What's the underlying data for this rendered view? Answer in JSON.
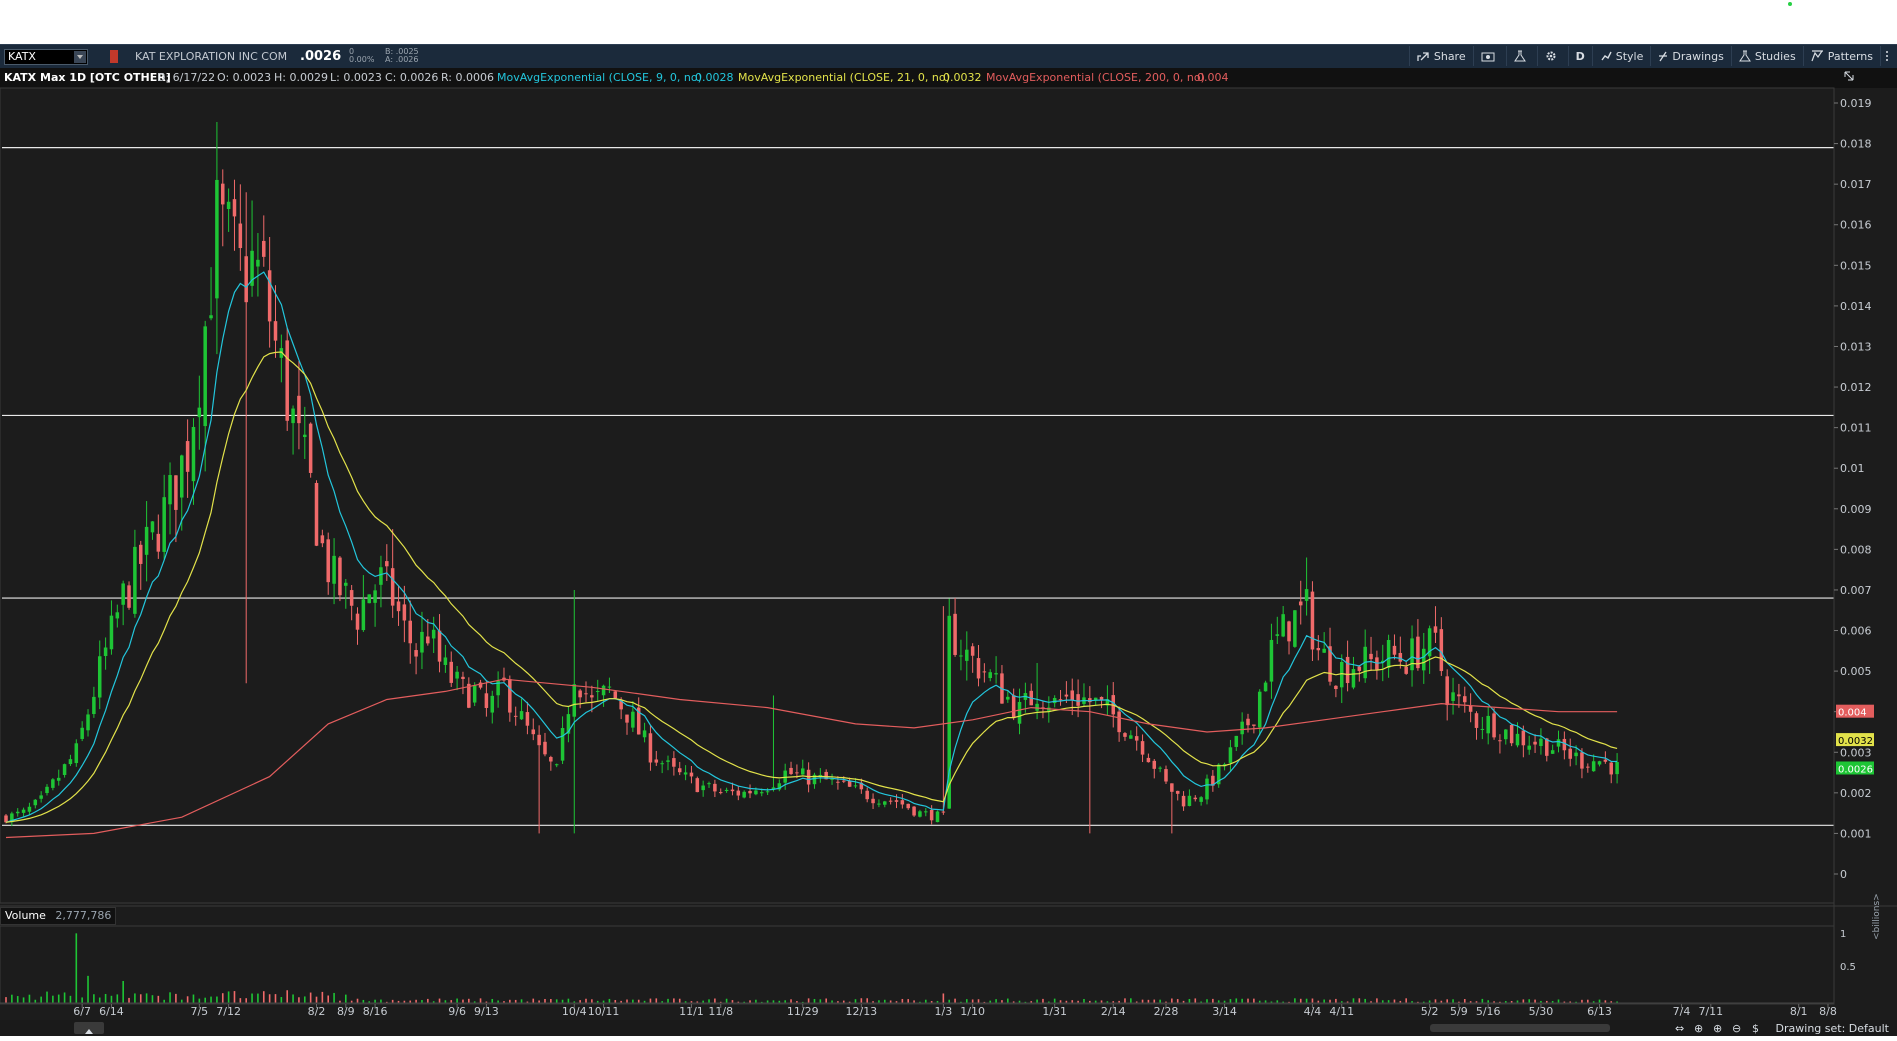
{
  "toolbar": {
    "symbol": "KATX",
    "company": "KAT EXPLORATION INC COM",
    "last": ".0026",
    "change": "0",
    "change_pct": "0.00%",
    "bid": "B: .0025",
    "ask": "A: .0026",
    "buttons": {
      "share": "Share",
      "period": "D",
      "style": "Style",
      "drawings": "Drawings",
      "studies": "Studies",
      "patterns": "Patterns"
    }
  },
  "header": {
    "title": "KATX Max 1D [OTC OTHER]",
    "date": "D: 6/17/22",
    "open": "O: 0.0023",
    "high": "H: 0.0029",
    "low": "L: 0.0023",
    "close": "C: 0.0026",
    "range": "R: 0.0006",
    "ema9_label": "MovAvgExponential (CLOSE, 9, 0, no)",
    "ema9_value": "0.0028",
    "ema21_label": "MovAvgExponential (CLOSE, 21, 0, no)",
    "ema21_value": "0.0032",
    "ema200_label": "MovAvgExponential (CLOSE, 200, 0, no)",
    "ema200_value": "0.004"
  },
  "volume_panel": {
    "label": "Volume",
    "value": "2,777,786",
    "unit": "<billions>",
    "ticks": [
      "1",
      "0.5"
    ]
  },
  "footer": {
    "drawing_set": "Drawing set: Default"
  },
  "colors": {
    "up": "#1ec535",
    "down": "#f06a6a",
    "ema9": "#23c6dc",
    "ema21": "#e2e24a",
    "ema200": "#e35d5d"
  },
  "chart_data": {
    "type": "candlestick",
    "ylim": [
      0,
      0.0195
    ],
    "y_ticks": [
      "0.019",
      "0.018",
      "0.017",
      "0.016",
      "0.015",
      "0.014",
      "0.013",
      "0.012",
      "0.011",
      "0.01",
      "0.009",
      "0.008",
      "0.007",
      "0.006",
      "0.005",
      "0.004",
      "0.003",
      "0.002",
      "0.001",
      "0"
    ],
    "x_ticks": [
      {
        "label": "6/7",
        "i": 13
      },
      {
        "label": "6/14",
        "i": 18
      },
      {
        "label": "7/5",
        "i": 33
      },
      {
        "label": "7/12",
        "i": 38
      },
      {
        "label": "8/2",
        "i": 53
      },
      {
        "label": "8/9",
        "i": 58
      },
      {
        "label": "8/16",
        "i": 63
      },
      {
        "label": "9/6",
        "i": 77
      },
      {
        "label": "9/13",
        "i": 82
      },
      {
        "label": "10/4",
        "i": 97
      },
      {
        "label": "10/11",
        "i": 102
      },
      {
        "label": "11/1",
        "i": 117
      },
      {
        "label": "11/8",
        "i": 122
      },
      {
        "label": "11/29",
        "i": 136
      },
      {
        "label": "12/13",
        "i": 146
      },
      {
        "label": "1/3",
        "i": 160
      },
      {
        "label": "1/10",
        "i": 165
      },
      {
        "label": "1/31",
        "i": 179
      },
      {
        "label": "2/14",
        "i": 189
      },
      {
        "label": "2/28",
        "i": 198
      },
      {
        "label": "3/14",
        "i": 208
      },
      {
        "label": "4/4",
        "i": 223
      },
      {
        "label": "4/11",
        "i": 228
      },
      {
        "label": "5/2",
        "i": 243
      },
      {
        "label": "5/9",
        "i": 248
      },
      {
        "label": "5/16",
        "i": 253
      },
      {
        "label": "5/30",
        "i": 262
      },
      {
        "label": "6/13",
        "i": 272
      },
      {
        "label": "7/4",
        "i": 286
      },
      {
        "label": "7/11",
        "i": 291
      },
      {
        "label": "8/1",
        "i": 306
      },
      {
        "label": "8/8",
        "i": 311
      }
    ],
    "horizontal_lines": [
      0.0179,
      0.0113,
      0.0068,
      0.0012
    ],
    "price_badges": [
      {
        "value": "0.004",
        "y": 0.004,
        "color": "#e35d5d",
        "text": "#ffffff"
      },
      {
        "value": "0.0032",
        "y": 0.0033,
        "color": "#e2e24a",
        "text": "#000000"
      },
      {
        "value": "0.0026",
        "y": 0.0026,
        "color": "#1ec535",
        "text": "#ffffff"
      }
    ],
    "anchors": [
      [
        0,
        0.0014
      ],
      [
        3,
        0.0015
      ],
      [
        6,
        0.0018
      ],
      [
        9,
        0.0024
      ],
      [
        12,
        0.003
      ],
      [
        16,
        0.005
      ],
      [
        20,
        0.0068
      ],
      [
        24,
        0.008
      ],
      [
        28,
        0.0092
      ],
      [
        31,
        0.0105
      ],
      [
        34,
        0.0135
      ],
      [
        36,
        0.016
      ],
      [
        38,
        0.0155
      ],
      [
        40,
        0.0148
      ],
      [
        42,
        0.015
      ],
      [
        44,
        0.0145
      ],
      [
        46,
        0.013
      ],
      [
        48,
        0.0118
      ],
      [
        50,
        0.0105
      ],
      [
        52,
        0.0095
      ],
      [
        54,
        0.008
      ],
      [
        56,
        0.0072
      ],
      [
        58,
        0.0068
      ],
      [
        60,
        0.0064
      ],
      [
        62,
        0.007
      ],
      [
        64,
        0.0072
      ],
      [
        66,
        0.0068
      ],
      [
        68,
        0.006
      ],
      [
        70,
        0.0055
      ],
      [
        72,
        0.006
      ],
      [
        74,
        0.0052
      ],
      [
        76,
        0.0048
      ],
      [
        78,
        0.0045
      ],
      [
        80,
        0.0045
      ],
      [
        82,
        0.004
      ],
      [
        85,
        0.0046
      ],
      [
        88,
        0.0038
      ],
      [
        91,
        0.003
      ],
      [
        94,
        0.0025
      ],
      [
        97,
        0.005
      ],
      [
        100,
        0.0042
      ],
      [
        103,
        0.0045
      ],
      [
        106,
        0.004
      ],
      [
        110,
        0.003
      ],
      [
        114,
        0.0025
      ],
      [
        118,
        0.0022
      ],
      [
        122,
        0.002
      ],
      [
        126,
        0.002
      ],
      [
        130,
        0.0022
      ],
      [
        133,
        0.0025
      ],
      [
        136,
        0.0024
      ],
      [
        140,
        0.0023
      ],
      [
        144,
        0.0021
      ],
      [
        148,
        0.0019
      ],
      [
        152,
        0.0018
      ],
      [
        156,
        0.0015
      ],
      [
        160,
        0.0014
      ],
      [
        161,
        0.006
      ],
      [
        164,
        0.0054
      ],
      [
        167,
        0.005
      ],
      [
        170,
        0.0045
      ],
      [
        173,
        0.004
      ],
      [
        176,
        0.0045
      ],
      [
        179,
        0.0042
      ],
      [
        182,
        0.0044
      ],
      [
        186,
        0.0042
      ],
      [
        190,
        0.0038
      ],
      [
        194,
        0.0032
      ],
      [
        198,
        0.0022
      ],
      [
        201,
        0.0018
      ],
      [
        204,
        0.002
      ],
      [
        207,
        0.0025
      ],
      [
        210,
        0.0032
      ],
      [
        213,
        0.004
      ],
      [
        216,
        0.0055
      ],
      [
        219,
        0.0062
      ],
      [
        222,
        0.0065
      ],
      [
        224,
        0.0055
      ],
      [
        227,
        0.005
      ],
      [
        230,
        0.0052
      ],
      [
        233,
        0.0052
      ],
      [
        236,
        0.0054
      ],
      [
        239,
        0.0053
      ],
      [
        242,
        0.0056
      ],
      [
        244,
        0.0056
      ],
      [
        246,
        0.0045
      ],
      [
        248,
        0.0042
      ],
      [
        251,
        0.0038
      ],
      [
        254,
        0.0037
      ],
      [
        257,
        0.0034
      ],
      [
        260,
        0.0033
      ],
      [
        263,
        0.0032
      ],
      [
        266,
        0.003
      ],
      [
        269,
        0.0028
      ],
      [
        272,
        0.0028
      ],
      [
        275,
        0.0026
      ]
    ],
    "spikes": [
      {
        "i": 36,
        "h": 0.0178
      },
      {
        "i": 37,
        "h": 0.0172
      },
      {
        "i": 41,
        "h": 0.0168
      },
      {
        "i": 66,
        "h": 0.0085
      },
      {
        "i": 97,
        "h": 0.007
      },
      {
        "i": 131,
        "h": 0.0044
      },
      {
        "i": 160,
        "h": 0.0066
      },
      {
        "i": 176,
        "h": 0.0052
      },
      {
        "i": 222,
        "h": 0.0078
      },
      {
        "i": 244,
        "h": 0.0066
      },
      {
        "i": 91,
        "l": 0.001
      },
      {
        "i": 97,
        "l": 0.001
      },
      {
        "i": 185,
        "l": 0.001
      },
      {
        "i": 199,
        "l": 0.001
      },
      {
        "i": 41,
        "l": 0.0047
      }
    ],
    "volume_spikes": [
      {
        "i": 12,
        "v": 0.95
      },
      {
        "i": 14,
        "v": 0.37
      },
      {
        "i": 20,
        "v": 0.3
      },
      {
        "i": 160,
        "v": 0.13
      }
    ],
    "ema200_points": [
      [
        0,
        0.0009
      ],
      [
        15,
        0.001
      ],
      [
        30,
        0.0014
      ],
      [
        45,
        0.0024
      ],
      [
        55,
        0.0037
      ],
      [
        65,
        0.0043
      ],
      [
        75,
        0.0045
      ],
      [
        85,
        0.0048
      ],
      [
        100,
        0.0046
      ],
      [
        115,
        0.0043
      ],
      [
        130,
        0.0041
      ],
      [
        145,
        0.0037
      ],
      [
        155,
        0.0036
      ],
      [
        165,
        0.0038
      ],
      [
        175,
        0.0041
      ],
      [
        185,
        0.004
      ],
      [
        195,
        0.0037
      ],
      [
        205,
        0.0035
      ],
      [
        215,
        0.0036
      ],
      [
        225,
        0.0038
      ],
      [
        235,
        0.004
      ],
      [
        245,
        0.0042
      ],
      [
        255,
        0.0041
      ],
      [
        265,
        0.004
      ],
      [
        275,
        0.004
      ]
    ],
    "bars": 276
  }
}
